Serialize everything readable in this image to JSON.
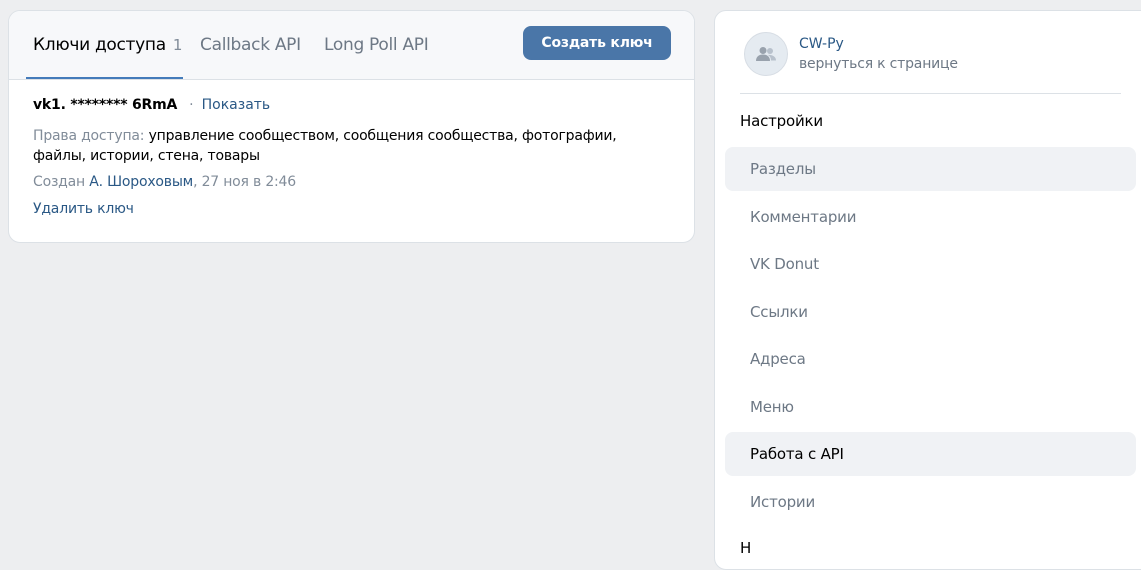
{
  "tabs": [
    {
      "label": "Ключи доступа",
      "count": "1",
      "active": true
    },
    {
      "label": "Callback API",
      "active": false
    },
    {
      "label": "Long Poll API",
      "active": false
    }
  ],
  "create_button": "Создать ключ",
  "key": {
    "name": "vk1. ******** 6RmA",
    "separator": "·",
    "show_link": "Показать",
    "access_label": "Права доступа:",
    "access_value": "управление сообществом, сообщения сообщества, фотографии, файлы, истории, стена, товары",
    "created_prefix": "Создан",
    "created_by": "А. Шороховым",
    "created_date": ", 27 ноя в 2:46",
    "delete_link": "Удалить ключ"
  },
  "sidebar": {
    "community_name": "CW-Py",
    "back_link": "вернуться к странице",
    "section_title": "Настройки",
    "items": [
      {
        "label": "Разделы",
        "state": "hover"
      },
      {
        "label": "Комментарии",
        "state": ""
      },
      {
        "label": "VK Donut",
        "state": ""
      },
      {
        "label": "Ссылки",
        "state": ""
      },
      {
        "label": "Адреса",
        "state": ""
      },
      {
        "label": "Меню",
        "state": ""
      },
      {
        "label": "Работа с API",
        "state": "selected"
      },
      {
        "label": "Истории",
        "state": ""
      }
    ],
    "cut_item": "Н"
  },
  "icons": {
    "avatar": "users-icon"
  },
  "colors": {
    "accent": "#4a76a8",
    "link": "#2a5885",
    "tab_underline": "#447bba"
  }
}
